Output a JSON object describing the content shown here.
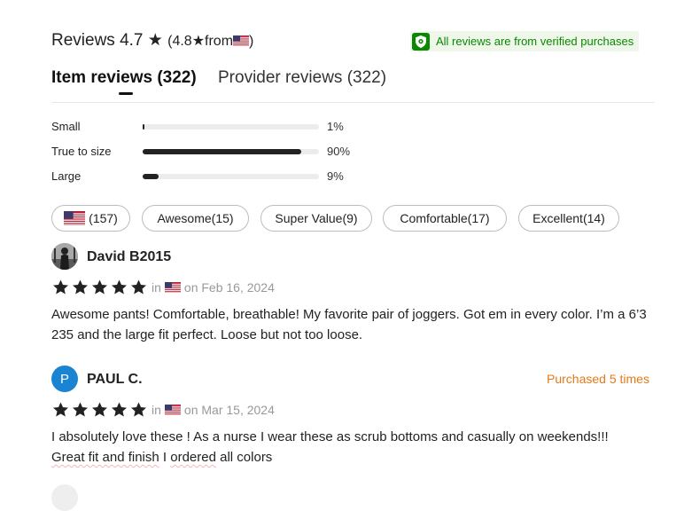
{
  "header": {
    "title": "Reviews 4.7",
    "star_glyph": "★",
    "provider_rating_open": "(4.8",
    "provider_rating_star": "★",
    "provider_rating_from": "from",
    "provider_rating_close": ")",
    "verified_text": "All reviews are from verified purchases",
    "verified_color": "#0a8800"
  },
  "tabs": [
    {
      "label": "Item reviews (322)",
      "active": true
    },
    {
      "label": "Provider reviews (322)",
      "active": false
    }
  ],
  "fit": [
    {
      "label": "Small",
      "value": 0.01,
      "percent_label": "1%"
    },
    {
      "label": "True to size",
      "value": 0.9,
      "percent_label": "90%"
    },
    {
      "label": "Large",
      "value": 0.09,
      "percent_label": "9%"
    }
  ],
  "filters": [
    {
      "label": "(157)",
      "icon": "us-flag-icon"
    },
    {
      "label": "Awesome(15)"
    },
    {
      "label": "Super Value(9)"
    },
    {
      "label": "Comfortable(17)"
    },
    {
      "label": "Excellent(14)"
    }
  ],
  "reviews": [
    {
      "name": "David B2015",
      "avatar": "photo",
      "rating": 5,
      "in_text": "in",
      "date_text": "on Feb 16, 2024",
      "text": "Awesome pants! Comfortable, breathable! My favorite pair of joggers. Got em in every color. I’m a 6’3 235 and the large fit perfect. Loose but not too loose."
    },
    {
      "name": "PAUL C.",
      "avatar_letter": "P",
      "avatar_color": "#1a84d2",
      "rating": 5,
      "in_text": "in",
      "date_text": "on Mar 15, 2024",
      "purchased": "Purchased 5 times",
      "text_line1": "I absolutely love these ! As a nurse I wear these as scrub bottoms and casually on weekends!!!",
      "text_line2_parts": [
        "Great fit and finish",
        " I ",
        "ordered",
        " all colors"
      ]
    }
  ],
  "colors": {
    "accent_orange": "#e47a1b",
    "star_color": "#222222",
    "meta_gray": "#999999"
  }
}
